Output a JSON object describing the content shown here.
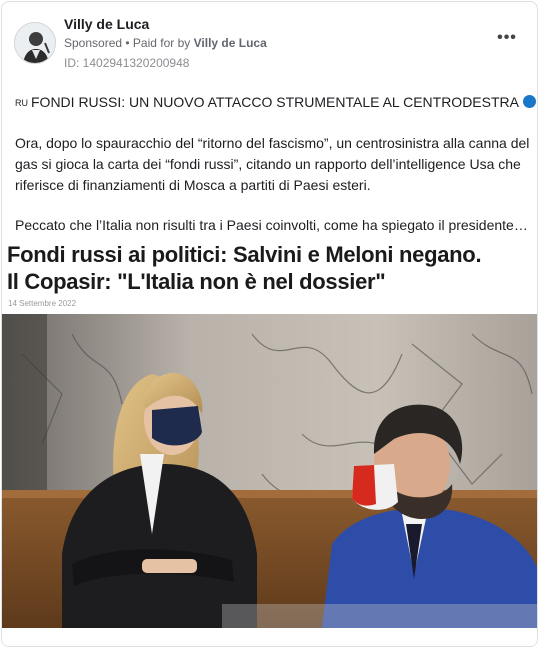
{
  "post": {
    "page_name": "Villy de Luca",
    "sponsored_label": "Sponsored",
    "separator": " • ",
    "paid_for_prefix": "Paid for by ",
    "paid_for_name": "Villy de Luca",
    "ad_id": "ID: 1402941320200948",
    "more_icon": "more-horizontal-icon",
    "more_label": "•••"
  },
  "text": {
    "lang_badge": "RU",
    "headline": "FONDI RUSSI: UN NUOVO ATTACCO STRUMENTALE AL CENTRODESTRA",
    "paragraph1": "Ora, dopo lo spauracchio del “ritorno del fascismo”, un centrosinistra alla canna del gas si gioca la carta dei “fondi russi”, citando un rapporto dell’intelligence Usa che riferisce di finanziamenti di Mosca a partiti di Paesi esteri.",
    "paragraph2": "Peccato che l’Italia non risulti tra i Paesi coinvolti, come ha spiegato il presidente…"
  },
  "creative": {
    "title_line1": "Fondi russi ai politici: Salvini e Meloni negano.",
    "title_line2": "Il Copasir: \"L'Italia non è nel dossier\"",
    "date": "14 Settembre 2022"
  },
  "colors": {
    "accent_blue": "#1877c8",
    "muted_text": "#65676b",
    "border": "#dcdfe4"
  }
}
